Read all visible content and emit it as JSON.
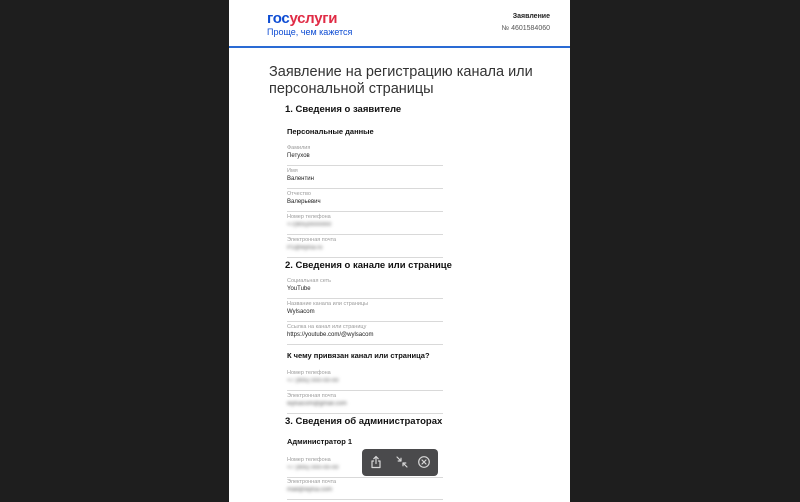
{
  "header": {
    "logo_part1": "гос",
    "logo_part2": "услуги",
    "tagline": "Проще, чем кажется",
    "doc_label": "Заявление",
    "doc_number": "№ 4601584060"
  },
  "title": "Заявление на регистрацию канала или персональной страницы",
  "sections": {
    "applicant": {
      "heading": "1. Сведения о заявителе",
      "subheading": "Персональные данные",
      "fields": [
        {
          "label": "Фамилия",
          "value": "Петухов"
        },
        {
          "label": "Имя",
          "value": "Валентин"
        },
        {
          "label": "Отчество",
          "value": "Валерьевич"
        },
        {
          "label": "Номер телефона",
          "value": "+7(905)0000000"
        },
        {
          "label": "Электронная почта",
          "value": "P1@wylsa.ru"
        }
      ]
    },
    "channel": {
      "heading": "2. Сведения о канале или странице",
      "fields": [
        {
          "label": "Социальная сеть",
          "value": "YouTube"
        },
        {
          "label": "Название канала или страницы",
          "value": "Wylsacom"
        },
        {
          "label": "Ссылка на канал или страницу",
          "value": "https://youtube.com/@wylsacom"
        }
      ],
      "subheading": "К чему привязан канал или страница?",
      "binding_fields": [
        {
          "label": "Номер телефона",
          "value": "+7 (905) 000-00-00"
        },
        {
          "label": "Электронная почта",
          "value": "wylsacom@gmail.com"
        }
      ]
    },
    "admins": {
      "heading": "3. Сведения об администраторах",
      "subheading": "Администратор 1",
      "fields": [
        {
          "label": "Номер телефона",
          "value": "+7 (905) 000-00-00"
        },
        {
          "label": "Электронная почта",
          "value": "mail@wylsa.com"
        }
      ]
    }
  },
  "toolbar": {
    "icons": [
      "share-icon",
      "collapse-icon",
      "close-icon"
    ]
  }
}
